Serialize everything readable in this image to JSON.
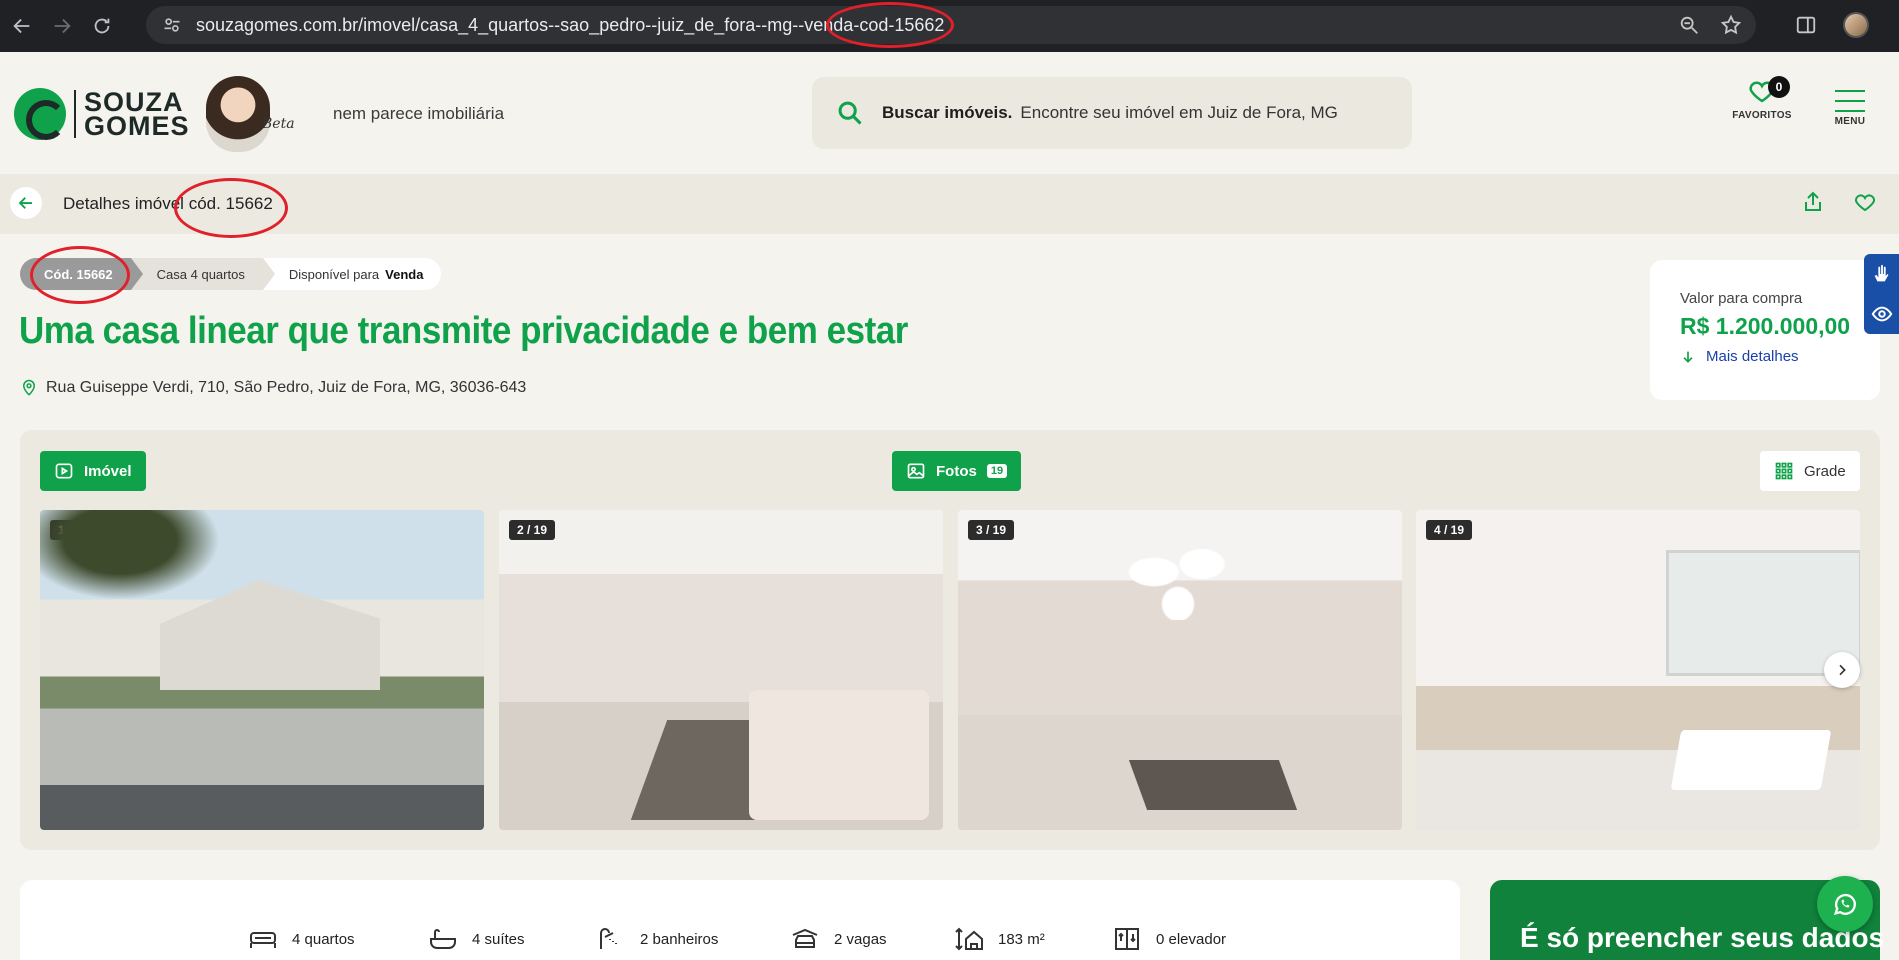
{
  "browser": {
    "url_main": "souzagomes.com.br/imovel/casa_4_quartos--sao_pedro--juiz_de_fora--mg--venda",
    "url_code": "-cod-15662"
  },
  "header": {
    "logo_line1": "SOUZA",
    "logo_line2": "GOMES",
    "signature": "Beta",
    "tagline": "nem parece imobiliária",
    "search_bold": "Buscar imóveis.",
    "search_hint": "Encontre seu imóvel em Juiz de Fora, MG",
    "favorites_count": "0",
    "favorites_label": "FAVORITOS",
    "menu_label": "MENU"
  },
  "detail_bar": {
    "title_prefix": "Detalhes imóvel",
    "title_code": "cód. 15662"
  },
  "breadcrumbs": {
    "code": "Cód. 15662",
    "type": "Casa 4 quartos",
    "available_prefix": "Disponível para",
    "available_value": "Venda"
  },
  "property": {
    "headline": "Uma casa linear que transmite privacidade e bem estar",
    "address": "Rua Guiseppe Verdi, 710, São Pedro, Juiz de Fora, MG, 36036-643"
  },
  "price": {
    "label": "Valor para compra",
    "value": "R$ 1.200.000,00",
    "more": "Mais detalhes"
  },
  "gallery": {
    "btn_property": "Imóvel",
    "btn_photos": "Fotos",
    "photos_count": "19",
    "btn_grid": "Grade",
    "photos": [
      {
        "label": "1 / 19"
      },
      {
        "label": "2 / 19"
      },
      {
        "label": "3 / 19"
      },
      {
        "label": "4 / 19"
      }
    ]
  },
  "features": [
    {
      "label": "4 quartos",
      "icon": "bed-icon"
    },
    {
      "label": "4 suítes",
      "icon": "bathtub-icon"
    },
    {
      "label": "2 banheiros",
      "icon": "shower-icon"
    },
    {
      "label": "2 vagas",
      "icon": "car-icon"
    },
    {
      "label": "183 m²",
      "icon": "area-icon"
    },
    {
      "label": "0 elevador",
      "icon": "elevator-icon"
    }
  ],
  "cta": {
    "text": "É só preencher seus dados"
  },
  "colors": {
    "brand_green": "#10a24a",
    "highlight_red": "#e0202a",
    "link_blue": "#1a3faa"
  }
}
